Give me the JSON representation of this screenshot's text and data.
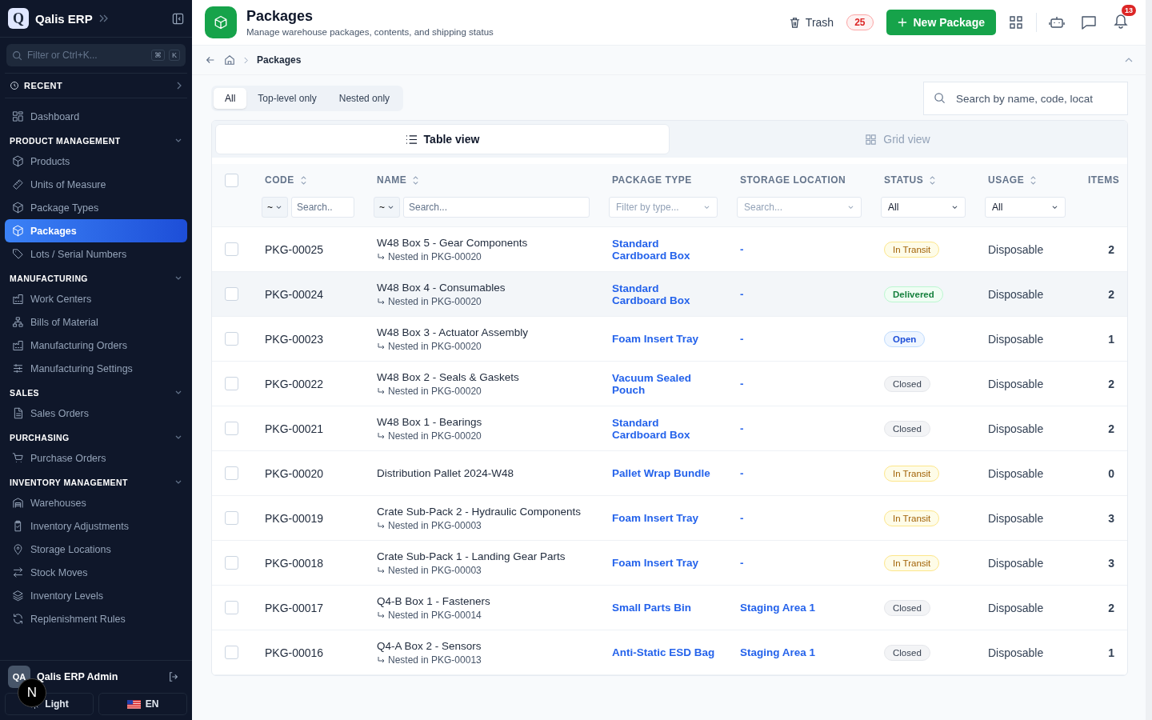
{
  "sidebar": {
    "brand": {
      "logo_letter": "Q",
      "name": "Qalis ERP"
    },
    "filter": {
      "placeholder": "Filter or Ctrl+K...",
      "keys": [
        "⌘",
        "K"
      ]
    },
    "recent": {
      "label": "RECENT"
    },
    "top_items": [
      {
        "label": "Dashboard",
        "selected": false
      }
    ],
    "sections": [
      {
        "title": "PRODUCT MANAGEMENT",
        "expanded": true,
        "items": [
          {
            "label": "Products",
            "selected": false
          },
          {
            "label": "Units of Measure",
            "selected": false
          },
          {
            "label": "Package Types",
            "selected": false
          },
          {
            "label": "Packages",
            "selected": true
          },
          {
            "label": "Lots / Serial Numbers",
            "selected": false
          }
        ]
      },
      {
        "title": "MANUFACTURING",
        "expanded": true,
        "items": [
          {
            "label": "Work Centers",
            "selected": false
          },
          {
            "label": "Bills of Material",
            "selected": false
          },
          {
            "label": "Manufacturing Orders",
            "selected": false
          },
          {
            "label": "Manufacturing Settings",
            "selected": false
          }
        ]
      },
      {
        "title": "SALES",
        "expanded": true,
        "items": [
          {
            "label": "Sales Orders",
            "selected": false
          }
        ]
      },
      {
        "title": "PURCHASING",
        "expanded": true,
        "items": [
          {
            "label": "Purchase Orders",
            "selected": false
          }
        ]
      },
      {
        "title": "INVENTORY MANAGEMENT",
        "expanded": true,
        "items": [
          {
            "label": "Warehouses",
            "selected": false
          },
          {
            "label": "Inventory Adjustments",
            "selected": false
          },
          {
            "label": "Storage Locations",
            "selected": false
          },
          {
            "label": "Stock Moves",
            "selected": false
          },
          {
            "label": "Inventory Levels",
            "selected": false
          },
          {
            "label": "Replenishment Rules",
            "selected": false
          }
        ]
      }
    ],
    "user": {
      "initials": "QA",
      "name": "Qalis ERP Admin"
    },
    "theme_button": "Light",
    "language_button": "EN"
  },
  "dev_badge": "N",
  "header": {
    "title": "Packages",
    "subtitle": "Manage warehouse packages, contents, and shipping status",
    "trash_label": "Trash",
    "trash_count": "25",
    "new_button": "New Package",
    "notification_count": "13"
  },
  "breadcrumb": [
    "Packages"
  ],
  "filter_tabs": [
    {
      "label": "All",
      "selected": true
    },
    {
      "label": "Top-level only",
      "selected": false
    },
    {
      "label": "Nested only",
      "selected": false
    }
  ],
  "search": {
    "placeholder": "Search by name, code, locat"
  },
  "view_tabs": [
    {
      "label": "Table view",
      "kind": "table",
      "selected": true
    },
    {
      "label": "Grid view",
      "kind": "grid",
      "selected": false
    }
  ],
  "table": {
    "select_all_checked": false,
    "columns": [
      {
        "label": "CODE",
        "sortable": true,
        "filter": {
          "kind": "text",
          "operator": "~",
          "placeholder": "Search.."
        }
      },
      {
        "label": "NAME",
        "sortable": true,
        "filter": {
          "kind": "text",
          "operator": "~",
          "placeholder": "Search..."
        }
      },
      {
        "label": "PACKAGE TYPE",
        "sortable": false,
        "filter": {
          "kind": "dropdown",
          "placeholder": "Filter by type..."
        }
      },
      {
        "label": "STORAGE LOCATION",
        "sortable": false,
        "filter": {
          "kind": "dropdown",
          "placeholder": "Search..."
        }
      },
      {
        "label": "STATUS",
        "sortable": true,
        "filter": {
          "kind": "select",
          "value": "All"
        }
      },
      {
        "label": "USAGE",
        "sortable": true,
        "filter": {
          "kind": "select",
          "value": "All"
        }
      },
      {
        "label": "ITEMS",
        "sortable": false
      }
    ],
    "rows": [
      {
        "checked": false,
        "highlighted": false,
        "code": "PKG-00025",
        "name": "W48 Box 5 - Gear Components",
        "parent": "Nested in PKG-00020",
        "package_type": "Standard Cardboard Box",
        "storage_location": "-",
        "status": {
          "label": "In Transit",
          "kind": "transit"
        },
        "usage": "Disposable",
        "items": "2"
      },
      {
        "checked": false,
        "highlighted": true,
        "code": "PKG-00024",
        "name": "W48 Box 4 - Consumables",
        "parent": "Nested in PKG-00020",
        "package_type": "Standard Cardboard Box",
        "storage_location": "-",
        "status": {
          "label": "Delivered",
          "kind": "delivered"
        },
        "usage": "Disposable",
        "items": "2"
      },
      {
        "checked": false,
        "highlighted": false,
        "code": "PKG-00023",
        "name": "W48 Box 3 - Actuator Assembly",
        "parent": "Nested in PKG-00020",
        "package_type": "Foam Insert Tray",
        "storage_location": "-",
        "status": {
          "label": "Open",
          "kind": "open"
        },
        "usage": "Disposable",
        "items": "1"
      },
      {
        "checked": false,
        "highlighted": false,
        "code": "PKG-00022",
        "name": "W48 Box 2 - Seals & Gaskets",
        "parent": "Nested in PKG-00020",
        "package_type": "Vacuum Sealed Pouch",
        "storage_location": "-",
        "status": {
          "label": "Closed",
          "kind": "closed"
        },
        "usage": "Disposable",
        "items": "2"
      },
      {
        "checked": false,
        "highlighted": false,
        "code": "PKG-00021",
        "name": "W48 Box 1 - Bearings",
        "parent": "Nested in PKG-00020",
        "package_type": "Standard Cardboard Box",
        "storage_location": "-",
        "status": {
          "label": "Closed",
          "kind": "closed"
        },
        "usage": "Disposable",
        "items": "2"
      },
      {
        "checked": false,
        "highlighted": false,
        "code": "PKG-00020",
        "name": "Distribution Pallet 2024-W48",
        "package_type": "Pallet Wrap Bundle",
        "storage_location": "-",
        "status": {
          "label": "In Transit",
          "kind": "transit"
        },
        "usage": "Disposable",
        "items": "0"
      },
      {
        "checked": false,
        "highlighted": false,
        "code": "PKG-00019",
        "name": "Crate Sub-Pack 2 - Hydraulic Components",
        "parent": "Nested in PKG-00003",
        "package_type": "Foam Insert Tray",
        "storage_location": "-",
        "status": {
          "label": "In Transit",
          "kind": "transit"
        },
        "usage": "Disposable",
        "items": "3"
      },
      {
        "checked": false,
        "highlighted": false,
        "code": "PKG-00018",
        "name": "Crate Sub-Pack 1 - Landing Gear Parts",
        "parent": "Nested in PKG-00003",
        "package_type": "Foam Insert Tray",
        "storage_location": "-",
        "status": {
          "label": "In Transit",
          "kind": "transit"
        },
        "usage": "Disposable",
        "items": "3"
      },
      {
        "checked": false,
        "highlighted": false,
        "code": "PKG-00017",
        "name": "Q4-B Box 1 - Fasteners",
        "parent": "Nested in PKG-00014",
        "package_type": "Small Parts Bin",
        "storage_location": "Staging Area 1",
        "status": {
          "label": "Closed",
          "kind": "closed"
        },
        "usage": "Disposable",
        "items": "2"
      },
      {
        "checked": false,
        "highlighted": false,
        "code": "PKG-00016",
        "name": "Q4-A Box 2 - Sensors",
        "parent": "Nested in PKG-00013",
        "package_type": "Anti-Static ESD Bag",
        "storage_location": "Staging Area 1",
        "status": {
          "label": "Closed",
          "kind": "closed"
        },
        "usage": "Disposable",
        "items": "1"
      }
    ]
  }
}
